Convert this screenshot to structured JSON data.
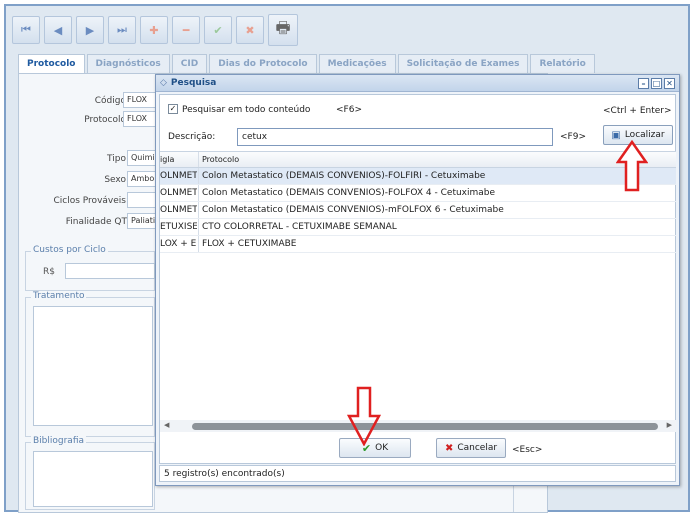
{
  "toolbar": {
    "buttons": [
      {
        "name": "first-record-button",
        "glyph": "⏮"
      },
      {
        "name": "previous-record-button",
        "glyph": "◀"
      },
      {
        "name": "next-record-button",
        "glyph": "▶"
      },
      {
        "name": "last-record-button",
        "glyph": "⏭"
      },
      {
        "name": "add-button",
        "glyph": "✚"
      },
      {
        "name": "remove-button",
        "glyph": "━"
      },
      {
        "name": "confirm-button",
        "glyph": "✔"
      },
      {
        "name": "cancel-edit-button",
        "glyph": "✖"
      },
      {
        "name": "print-button",
        "glyph": "🖶"
      }
    ]
  },
  "tabs": [
    "Protocolo",
    "Diagnósticos",
    "CID",
    "Dias do Protocolo",
    "Medicações",
    "Solicitação de Exames",
    "Relatório"
  ],
  "form": {
    "codigo_label": "Código:",
    "codigo_value": "FLOX",
    "protocolo_label": "Protocolo:",
    "protocolo_value": "FLOX",
    "tipo_label": "Tipo:",
    "tipo_value": "Quimi",
    "sexo_label": "Sexo:",
    "sexo_value": "Ambo",
    "ciclos_label": "Ciclos Prováveis:",
    "finalidade_label": "Finalidade QT:",
    "finalidade_value": "Paliati",
    "custos_legend": "Custos por Ciclo",
    "currency": "R$",
    "tratamento_legend": "Tratamento",
    "bibliografia_legend": "Bibliografia"
  },
  "dialog": {
    "title": "Pesquisa",
    "search_all_label": "Pesquisar em todo conteúdo",
    "search_all_checked": "✓",
    "search_all_shortcut": "<F6>",
    "ctrl_enter_shortcut": "<Ctrl + Enter>",
    "descricao_label": "Descrição:",
    "descricao_value": "cetux",
    "descricao_shortcut": "<F9>",
    "localizar_label": "Localizar",
    "columns": [
      "igla",
      "Protocolo"
    ],
    "rows": [
      {
        "sigla": "OLNMET",
        "protocolo": "Colon Metastatico (DEMAIS CONVENIOS)-FOLFIRI - Cetuximabe"
      },
      {
        "sigla": "OLNMET",
        "protocolo": "Colon Metastatico (DEMAIS CONVENIOS)-FOLFOX 4 - Cetuximabe"
      },
      {
        "sigla": "OLNMET",
        "protocolo": "Colon Metastatico (DEMAIS CONVENIOS)-mFOLFOX 6 - Cetuximabe"
      },
      {
        "sigla": "ETUXISE",
        "protocolo": "CTO COLORRETAL - CETUXIMABE SEMANAL"
      },
      {
        "sigla": "LOX + E",
        "protocolo": "FLOX + CETUXIMABE"
      }
    ],
    "ok_label": "OK",
    "cancelar_label": "Cancelar",
    "esc_shortcut": "<Esc>",
    "status": "5 registro(s) encontrado(s)"
  },
  "colors": {
    "accent": "#1f5aa0",
    "highlight_arrow": "#e02020",
    "selected_row": "#dfe9f6"
  }
}
